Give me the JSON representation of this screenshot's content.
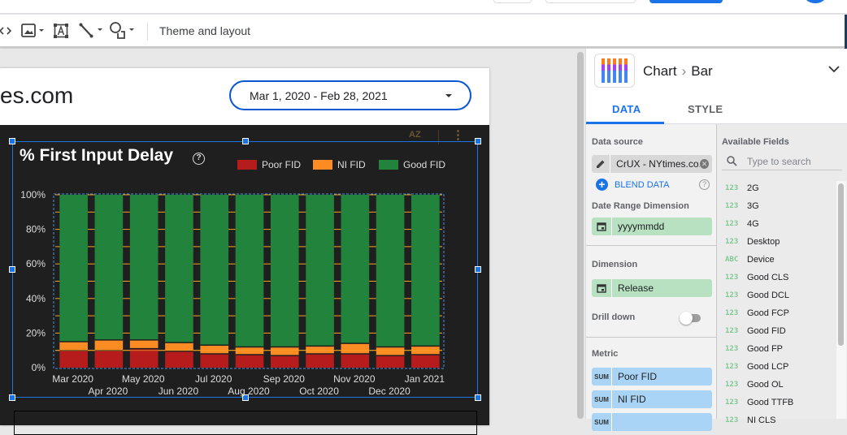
{
  "toolbar": {
    "theme_label": "Theme and layout",
    "tools": [
      "code-embed-icon",
      "image-icon",
      "text-icon",
      "line-icon",
      "shape-icon"
    ]
  },
  "report": {
    "title_partial": "es.com",
    "date_range": "Mar 1, 2020 - Feb 28, 2021"
  },
  "chart": {
    "title": "% First Input Delay",
    "help": "?",
    "sort_label": "AZ"
  },
  "chart_data": {
    "type": "bar",
    "stacked": true,
    "title": "% First Input Delay",
    "xlabel": "",
    "ylabel": "",
    "ylim": [
      0,
      100
    ],
    "yticks": [
      "0%",
      "20%",
      "40%",
      "60%",
      "80%",
      "100%"
    ],
    "grid": true,
    "legend_position": "top-right",
    "categories": [
      "Mar 2020",
      "Apr 2020",
      "May 2020",
      "Jun 2020",
      "Jul 2020",
      "Aug 2020",
      "Sep 2020",
      "Oct 2020",
      "Nov 2020",
      "Dec 2020",
      "Jan 2021"
    ],
    "series": [
      {
        "name": "Poor FID",
        "color": "#b71c1c",
        "values": [
          10,
          10,
          11,
          9.5,
          8,
          7.5,
          7,
          8,
          8,
          7,
          7.5
        ]
      },
      {
        "name": "NI FID",
        "color": "#fb8c23",
        "values": [
          5,
          6,
          5,
          5,
          5,
          4.5,
          5,
          4.5,
          6,
          5,
          5
        ]
      },
      {
        "name": "Good FID",
        "color": "#22843c",
        "values": [
          85,
          84,
          84,
          85.5,
          87,
          88,
          88,
          87.5,
          86,
          88,
          87.5
        ]
      }
    ]
  },
  "panel": {
    "breadcrumb_1": "Chart",
    "breadcrumb_2": "Bar",
    "tabs": [
      {
        "label": "DATA",
        "active": true
      },
      {
        "label": "STYLE",
        "active": false
      }
    ],
    "data_source_label": "Data source",
    "data_source_value": "CrUX - NYtimes.co...",
    "blend_label": "BLEND DATA",
    "date_range_dim_label": "Date Range Dimension",
    "date_range_dim_value": "yyyymmdd",
    "dimension_label": "Dimension",
    "dimension_value": "Release",
    "drill_down_label": "Drill down",
    "drill_down_on": false,
    "metric_label": "Metric",
    "metrics": [
      {
        "agg": "SUM",
        "name": "Poor FID"
      },
      {
        "agg": "SUM",
        "name": "NI FID"
      },
      {
        "agg": "SUM",
        "name": ""
      }
    ],
    "available_fields_label": "Available Fields",
    "search_placeholder": "Type to search",
    "fields": [
      {
        "type": "123",
        "name": "2G"
      },
      {
        "type": "123",
        "name": "3G"
      },
      {
        "type": "123",
        "name": "4G"
      },
      {
        "type": "123",
        "name": "Desktop"
      },
      {
        "type": "ABC",
        "name": "Device"
      },
      {
        "type": "123",
        "name": "Good CLS"
      },
      {
        "type": "123",
        "name": "Good DCL"
      },
      {
        "type": "123",
        "name": "Good FCP"
      },
      {
        "type": "123",
        "name": "Good FID"
      },
      {
        "type": "123",
        "name": "Good FP"
      },
      {
        "type": "123",
        "name": "Good LCP"
      },
      {
        "type": "123",
        "name": "Good OL"
      },
      {
        "type": "123",
        "name": "Good TTFB"
      },
      {
        "type": "123",
        "name": "NI CLS"
      }
    ]
  }
}
